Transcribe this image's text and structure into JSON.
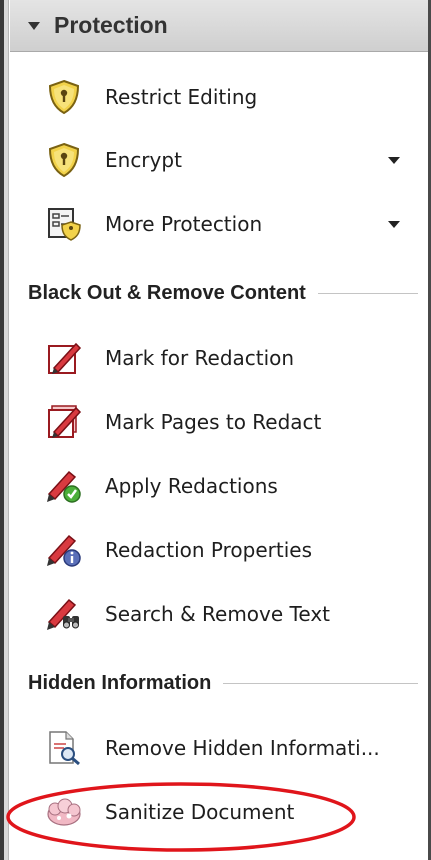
{
  "panel": {
    "title": "Protection"
  },
  "protection_items": [
    {
      "label": "Restrict Editing",
      "icon": "shield-key-icon",
      "has_menu": false
    },
    {
      "label": "Encrypt",
      "icon": "shield-key-icon",
      "has_menu": true
    },
    {
      "label": "More Protection",
      "icon": "form-shield-icon",
      "has_menu": true
    }
  ],
  "sections": {
    "blackout": {
      "title": "Black Out & Remove Content",
      "items": [
        {
          "label": "Mark for Redaction",
          "icon": "redaction-marker-icon"
        },
        {
          "label": "Mark Pages to Redact",
          "icon": "redaction-pages-icon"
        },
        {
          "label": "Apply Redactions",
          "icon": "apply-redactions-icon"
        },
        {
          "label": "Redaction Properties",
          "icon": "redaction-properties-icon"
        },
        {
          "label": "Search & Remove Text",
          "icon": "search-remove-text-icon"
        }
      ]
    },
    "hidden": {
      "title": "Hidden Information",
      "items": [
        {
          "label": "Remove Hidden Informati...",
          "icon": "remove-hidden-info-icon"
        },
        {
          "label": "Sanitize Document",
          "icon": "sanitize-document-icon"
        }
      ]
    }
  },
  "colors": {
    "highlight": "#e0151b",
    "shield": "#e8c640",
    "marker": "#d0323a"
  }
}
